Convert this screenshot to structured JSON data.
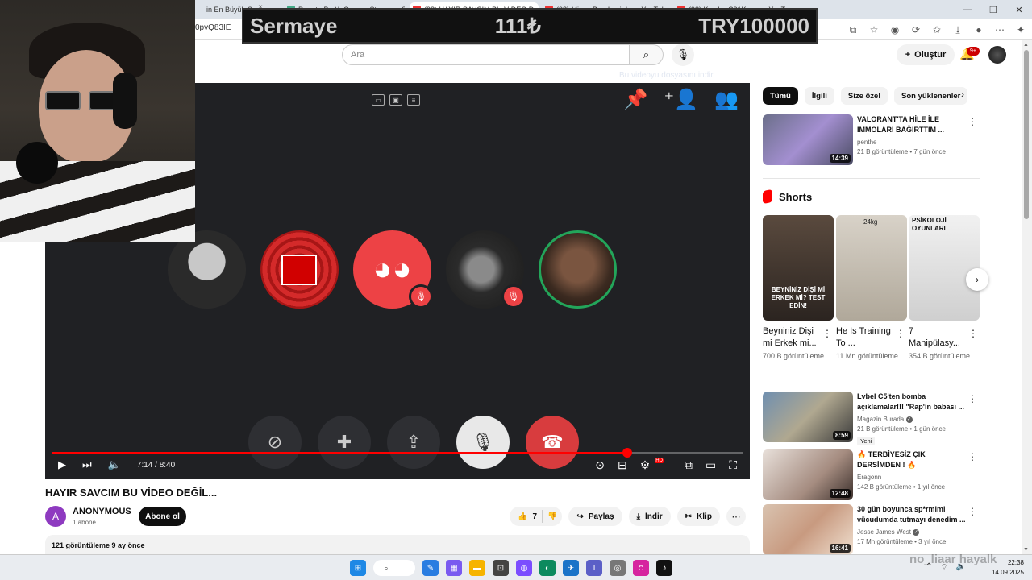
{
  "browser": {
    "tabs": [
      {
        "label": "in En Büyük Oyunu: Pay..."
      },
      {
        "label": "Donate By NoGame - Streamer S..."
      },
      {
        "label": "(98) HAYIR SAVCIM BU VİDEO D..."
      },
      {
        "label": "(98) Mizan Burak stüdyo - YouTube"
      },
      {
        "label": "(98) Kim bu C31K ge... - YouT..."
      }
    ],
    "url": "0pvQ83IE"
  },
  "overlay": {
    "label": "Sermaye",
    "amount": "111₺",
    "target": "TRY100000"
  },
  "header": {
    "search_placeholder": "Ara",
    "create_label": "Oluştur",
    "notif_count": "9+"
  },
  "player": {
    "download_hint": "Bu videoyu dosyasını indir",
    "time": "7:14 / 8:40",
    "progress": 0.832,
    "hd_badge": "HD"
  },
  "video": {
    "title": "HAYIR SAVCIM BU VİDEO DEĞİL...",
    "channel_initial": "A",
    "channel": "ANONYMOUS",
    "subs": "1 abone",
    "subscribe": "Abone ol",
    "likes": "7",
    "share": "Paylaş",
    "download": "İndir",
    "clip": "Klip",
    "views_date": "121 görüntüleme  9 ay önce"
  },
  "sidebar": {
    "chips": [
      "Tümü",
      "İlgili",
      "Size özel",
      "Son yüklenenler"
    ],
    "shorts_heading": "Shorts",
    "recs": [
      {
        "title": "VALORANT'TA HİLE İLE İMMOLARI BAĞIRTTIM ...",
        "channel": "penthe",
        "meta": "21 B görüntüleme • 7 gün önce",
        "duration": "14:39"
      },
      {
        "title": "Lvbel C5'ten bomba açıklamalar!!! \"Rap'in babası ...",
        "channel": "Magazin Burada",
        "meta": "21 B görüntüleme • 1 gün önce",
        "duration": "8:59",
        "tag": "Yeni"
      },
      {
        "title": "🔥 TERBİYESİZ ÇIK DERSİMDEN ! 🔥",
        "channel": "Eragonn",
        "meta": "142 B görüntüleme • 1 yıl önce",
        "duration": "12:48"
      },
      {
        "title": "30 gün boyunca sp*rmimi vücudumda tutmayı denedim ...",
        "channel": "Jesse James West",
        "meta": "17 Mn görüntüleme • 3 yıl önce",
        "duration": "16:41"
      }
    ],
    "shorts": [
      {
        "title": "Beyniniz Dişi mi Erkek mi...",
        "views": "700 B görüntüleme",
        "thumb_text": "BEYNİNİZ DİŞİ Mİ ERKEK Mİ? TEST EDİN!"
      },
      {
        "title": "He Is Training To ...",
        "views": "11 Mn görüntüleme",
        "thumb_text": "24kg"
      },
      {
        "title": "7 Manipülasy...",
        "views": "354 B görüntüleme",
        "thumb_text": "PSİKOLOJİ OYUNLARI"
      }
    ]
  },
  "taskbar": {
    "search_label": "Ara",
    "time": "22:38",
    "date": "14.09.2025"
  },
  "watermark": "no_liaar hayalk"
}
